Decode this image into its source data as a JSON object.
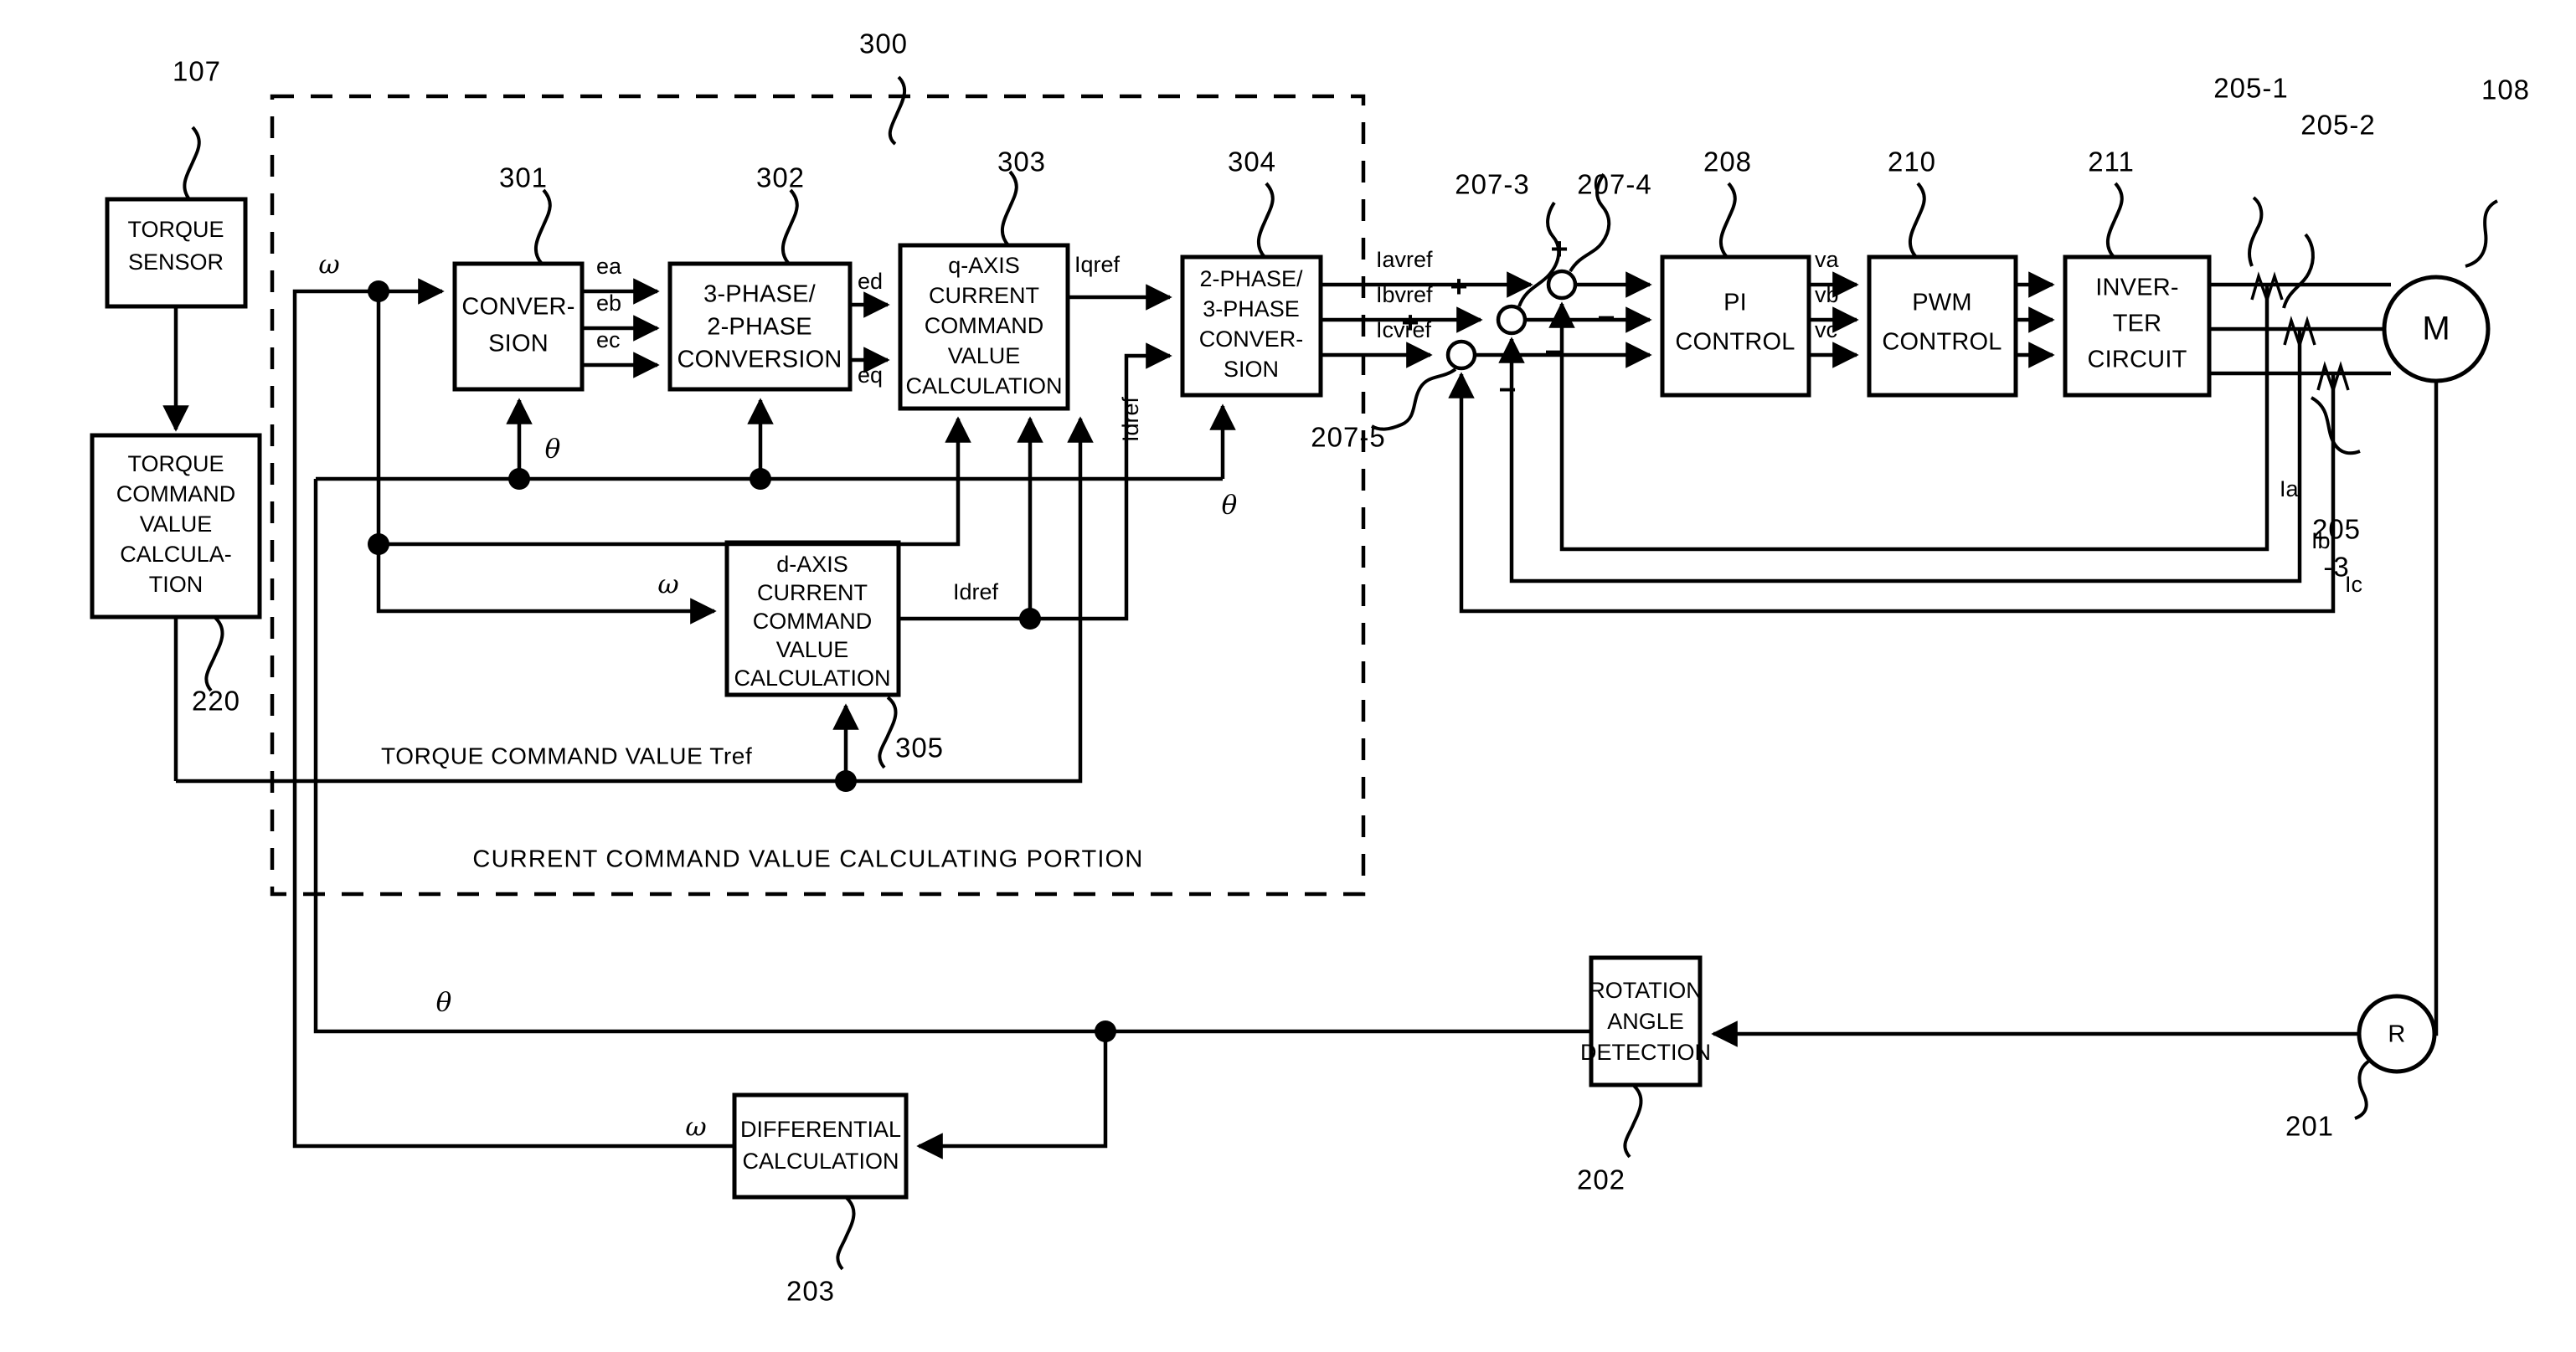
{
  "figure": {
    "type": "patent-block-diagram",
    "caption": "CURRENT COMMAND VALUE CALCULATING PORTION",
    "torque_command_line_label": "TORQUE COMMAND VALUE Tref"
  },
  "blocks": {
    "torque_sensor": {
      "lines": [
        "TORQUE",
        "SENSOR"
      ],
      "ref": "107"
    },
    "torque_cmd_calc": {
      "lines": [
        "TORQUE",
        "COMMAND",
        "VALUE",
        "CALCULA-",
        "TION"
      ],
      "ref": "220"
    },
    "conversion": {
      "lines": [
        "CONVER-",
        "SION"
      ],
      "ref": "301"
    },
    "three_to_two_phase": {
      "lines": [
        "3-PHASE/",
        "2-PHASE",
        "CONVERSION"
      ],
      "ref": "302"
    },
    "q_axis_calc": {
      "lines": [
        "q-AXIS",
        "CURRENT",
        "COMMAND",
        "VALUE",
        "CALCULATION"
      ],
      "ref": "303"
    },
    "two_to_three_phase": {
      "lines": [
        "2-PHASE/",
        "3-PHASE",
        "CONVER-",
        "SION"
      ],
      "ref": "304"
    },
    "d_axis_calc": {
      "lines": [
        "d-AXIS",
        "CURRENT",
        "COMMAND",
        "VALUE",
        "CALCULATION"
      ],
      "ref": "305"
    },
    "pi_control": {
      "lines": [
        "PI",
        "CONTROL"
      ],
      "ref": "208"
    },
    "pwm_control": {
      "lines": [
        "PWM",
        "CONTROL"
      ],
      "ref": "210"
    },
    "inverter_circuit": {
      "lines": [
        "INVER-",
        "TER",
        "CIRCUIT"
      ],
      "ref": "211"
    },
    "rotation_angle_detection": {
      "lines": [
        "ROTATION",
        "ANGLE",
        "DETECTION"
      ],
      "ref": "202"
    },
    "differential_calculation": {
      "lines": [
        "DIFFERENTIAL",
        "CALCULATION"
      ],
      "ref": "203"
    },
    "motor": {
      "label": "M",
      "ref": "108"
    },
    "resolver": {
      "label": "R",
      "ref": "201"
    }
  },
  "group_ref": "300",
  "summing_junctions": [
    {
      "ref": "207-3",
      "plus": "+",
      "minus": "−"
    },
    {
      "ref": "207-4",
      "plus": "+",
      "minus": "−"
    },
    {
      "ref": "207-5",
      "plus": "+",
      "minus": "−"
    }
  ],
  "current_sensors": [
    {
      "ref": "205-1"
    },
    {
      "ref": "205-2"
    },
    {
      "ref": "205",
      "ref2": "-3"
    }
  ],
  "signals": {
    "omega": "ω",
    "theta": "θ",
    "ea": "ea",
    "eb": "eb",
    "ec": "ec",
    "ed": "ed",
    "eq": "eq",
    "iqref": "Iqref",
    "idref": "Idref",
    "iavref": "Iavref",
    "ibvref": "Ibvref",
    "icvref": "Icvref",
    "va": "va",
    "vb": "vb",
    "vc": "vc",
    "ia": "Ia",
    "ib": "Ib",
    "ic": "Ic"
  },
  "colors": {
    "ink": "#000000",
    "paper": "#ffffff"
  }
}
